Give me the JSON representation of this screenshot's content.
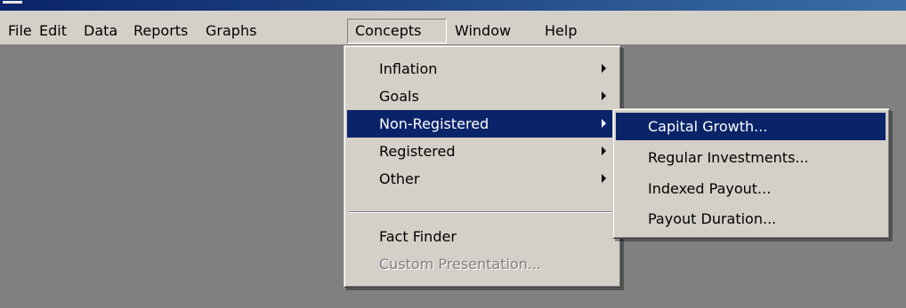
{
  "menubar": {
    "items": [
      "File",
      "Edit",
      "Data",
      "Reports",
      "Graphs",
      "Concepts",
      "Window",
      "Help"
    ],
    "open_item": "Concepts"
  },
  "concepts_menu": {
    "items": [
      {
        "label": "Inflation",
        "submenu": true,
        "state": "normal"
      },
      {
        "label": "Goals",
        "submenu": true,
        "state": "normal"
      },
      {
        "label": "Non-Registered",
        "submenu": true,
        "state": "highlighted"
      },
      {
        "label": "Registered",
        "submenu": true,
        "state": "normal"
      },
      {
        "label": "Other",
        "submenu": true,
        "state": "normal"
      },
      {
        "label": "Fact Finder",
        "submenu": false,
        "state": "normal"
      },
      {
        "label": "Custom Presentation...",
        "submenu": false,
        "state": "disabled"
      }
    ]
  },
  "non_registered_submenu": {
    "items": [
      {
        "label": "Capital Growth...",
        "state": "highlighted"
      },
      {
        "label": "Regular Investments...",
        "state": "normal"
      },
      {
        "label": "Indexed Payout...",
        "state": "normal"
      },
      {
        "label": "Payout Duration...",
        "state": "normal"
      }
    ]
  },
  "colors": {
    "menu_background": "#d4d0c8",
    "highlight": "#0a246a",
    "workspace": "#808080",
    "disabled_text": "#808080"
  }
}
